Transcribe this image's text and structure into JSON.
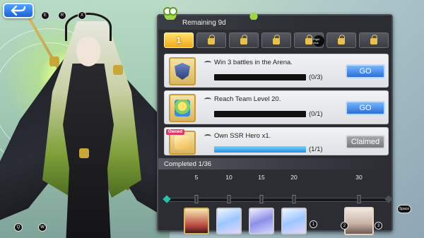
{
  "header": {
    "remaining": "Remaining 9d"
  },
  "tabs": [
    {
      "label": "1",
      "state": "active"
    },
    {
      "label": "",
      "state": "locked"
    },
    {
      "label": "",
      "state": "locked"
    },
    {
      "label": "",
      "state": "locked"
    },
    {
      "label": "",
      "state": "locked"
    },
    {
      "label": "",
      "state": "locked"
    },
    {
      "label": "",
      "state": "locked"
    }
  ],
  "tab_key_hint": "Right click",
  "missions": [
    {
      "title": "Win 3 battles in the Arena.",
      "progress_text": "(0/3)",
      "progress": 0.0,
      "button": "GO",
      "icon": "arena-shield-icon"
    },
    {
      "title": "Reach Team Level 20.",
      "progress_text": "(0/1)",
      "progress": 0.0,
      "button": "GO",
      "icon": "level-up-icon"
    },
    {
      "title": "Own SSR Hero x1.",
      "progress_text": "(1/1)",
      "progress": 1.0,
      "button": "Claimed",
      "badge": "Owned",
      "icon": "hero-card-icon"
    }
  ],
  "completed": "Completed 1/36",
  "milestones": [
    {
      "label": "5",
      "reward": "hero-portrait"
    },
    {
      "label": "10",
      "reward": "card"
    },
    {
      "label": "15",
      "reward": "weapon"
    },
    {
      "label": "20",
      "reward": "card"
    },
    {
      "label": "30",
      "reward": "hero-portrait"
    }
  ],
  "key_hints": {
    "e": "E",
    "r": "R",
    "x": "X",
    "q": "Q",
    "w": "W",
    "one": "1",
    "two": "2",
    "three": "3",
    "space": "Space"
  },
  "colors": {
    "accent_go": "#2d6ed6",
    "tab_active": "#f2a81e",
    "progress_fill": "#2b8fe0"
  }
}
